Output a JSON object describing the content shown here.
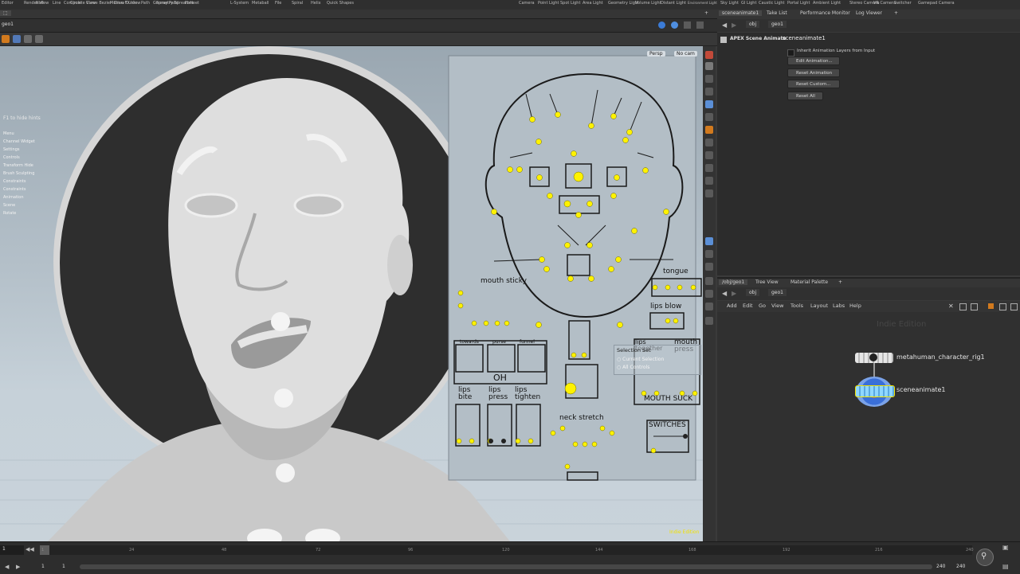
{
  "shelf": {
    "items": [
      "Editor",
      "Render View",
      "Composite View",
      "Motion FX View",
      "Geometry Spreadsheet"
    ],
    "tools": [
      "Null",
      "Line",
      "Circle",
      "Curve Bezier",
      "Draw Curve",
      "Path",
      "Spray Paint",
      "Font",
      "L-System",
      "Metaball",
      "File",
      "Spiral",
      "Helix",
      "Quick Shapes"
    ],
    "lights": [
      "Camera",
      "Point Light",
      "Spot Light",
      "Area Light",
      "Geometry Light",
      "Volume Light",
      "Distant Light",
      "Environment Light",
      "Sky Light",
      "GI Light",
      "Caustic Light",
      "Portal Light",
      "Ambient Light",
      "Stereo Camera",
      "VR Camera",
      "Switcher",
      "Gamepad Camera"
    ]
  },
  "viewport": {
    "path": "geo1",
    "persp": "Persp",
    "cam": "No cam",
    "hints_title": "F1 to hide hints",
    "hints": [
      "Menu",
      "Channel Widget",
      "Settings",
      "Controls",
      "Transform Hide",
      "Brush Sculpting",
      "Constraints",
      "Constraints",
      "Animation",
      "Scene",
      "Rotate"
    ],
    "indie_label": "Indie Edition"
  },
  "face_board": {
    "labels": {
      "sticky": "mouth sticky",
      "tongue": "tongue",
      "lips_blow": "lips blow",
      "towards": "towards",
      "purse": "purse",
      "funnel": "funnel",
      "oh": "OH",
      "lips_bite": "lips bite",
      "lips_press": "lips press",
      "lips_tighten": "lips tighten",
      "neck_stretch": "neck stretch",
      "lips_together": "lips together",
      "mouth_press": "mouth press",
      "mouth_suck": "MOUTH SUCK",
      "switches": "SWITCHES"
    },
    "selection": {
      "title": "Selection Set",
      "item1": "Current Selection",
      "item2": "All Controls"
    }
  },
  "right_panel": {
    "tabs": [
      "sceneanimate1",
      "Take List",
      "Performance Monitor",
      "Log Viewer"
    ],
    "nav_obj": "obj",
    "nav_geo": "geo1",
    "node_type": "APEX Scene Animate",
    "node_name": "sceneanimate1",
    "inherit_label": "Inherit Animation Layers from Input",
    "buttons": [
      "Edit Animation...",
      "Reset Animation",
      "Reset Custom...",
      "Reset All"
    ]
  },
  "network": {
    "tabs": [
      "/obj/geo1",
      "Tree View",
      "Material Palette"
    ],
    "nav_obj": "obj",
    "nav_geo": "geo1",
    "menu": [
      "Add",
      "Edit",
      "Go",
      "View",
      "Tools",
      "Layout",
      "Labs",
      "Help"
    ],
    "watermark": "Indie Edition",
    "nodes": [
      "metahuman_character_rig1",
      "sceneanimate1"
    ]
  },
  "timeline": {
    "ticks": [
      "1",
      "24",
      "48",
      "72",
      "96",
      "120",
      "144",
      "168",
      "192",
      "216",
      "240"
    ],
    "current_frame": "1",
    "start": "1",
    "start2": "1",
    "end": "240",
    "end2": "240"
  },
  "colors": {
    "accent": "#e8e100",
    "control_yellow": "#fff200",
    "node_blue": "#3a6fd8"
  }
}
